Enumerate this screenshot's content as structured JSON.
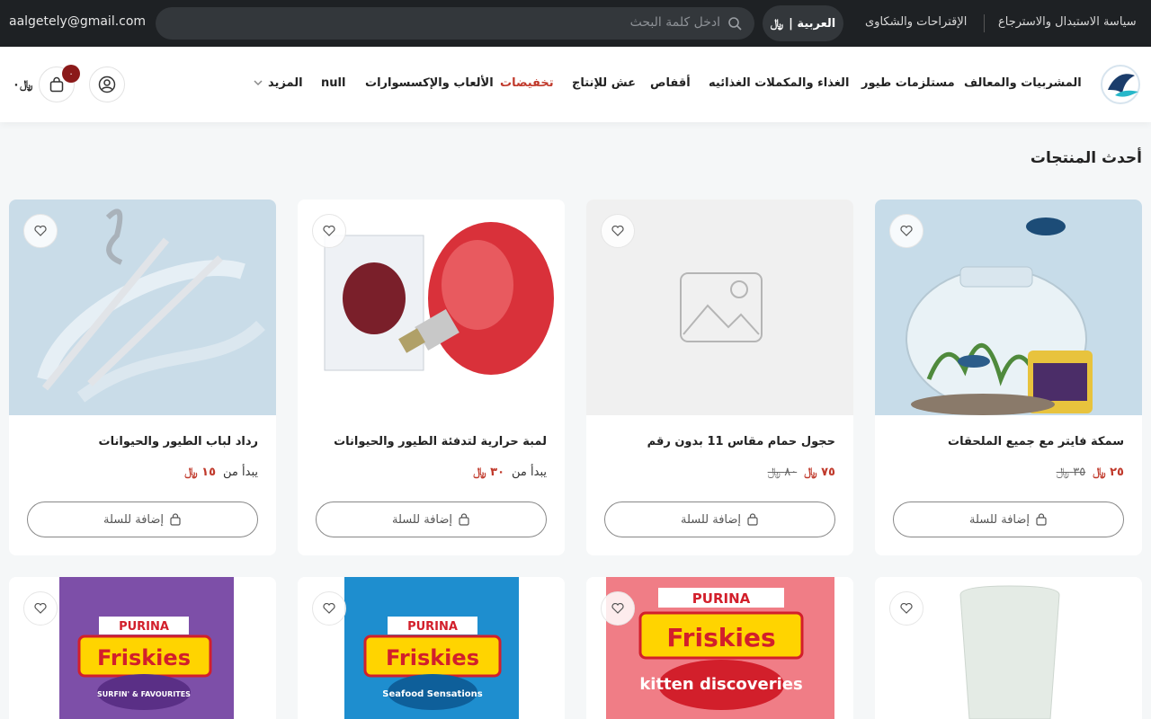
{
  "topbar": {
    "email": "aalgetely@gmail.com",
    "search_placeholder": "ادخل كلمة البحث",
    "language": "العربية |",
    "currency_symbol": "﷼",
    "links": [
      "سياسة الاستبدال والاسترجاع",
      "الإقتراحات والشكاوى"
    ]
  },
  "nav": {
    "items": [
      "المشربيات والمعالف",
      "مستلزمات طيور",
      "الغذاء والمكملات الغذائيه",
      "أقفاص",
      "عش للإنتاج",
      "تخفيضات",
      "الألعاب والإكسسوارات",
      "null",
      "المزيد"
    ],
    "cart_badge": "٠",
    "cart_total": "٠"
  },
  "section": {
    "title": "أحدث المنتجات"
  },
  "products": [
    {
      "name": "سمكة فايتر مع جميع الملحقات",
      "price": "٢٥",
      "old_price": "٣٥",
      "from": "",
      "add_label": "إضافة للسلة"
    },
    {
      "name": "حجول حمام مقاس 11 بدون رقم",
      "price": "٧٥",
      "old_price": "٨٠",
      "from": "",
      "add_label": "إضافة للسلة"
    },
    {
      "name": "لمبة حرارية لتدفئة الطيور والحيوانات",
      "price": "٣٠",
      "old_price": "",
      "from": "يبدأ من",
      "add_label": "إضافة للسلة"
    },
    {
      "name": "رداد لباب الطيور والحيوانات",
      "price": "١٥",
      "old_price": "",
      "from": "يبدأ من",
      "add_label": "إضافة للسلة"
    }
  ],
  "product_images": {
    "row2": [
      "PURINA",
      "Friskies",
      "SURFIN' & FAVOURITES",
      "Seafood Sensations",
      "kitten discoveries"
    ]
  },
  "colors": {
    "topbar_bg": "#1e2124",
    "accent": "#c0392b",
    "badge": "#8b1a1a"
  }
}
